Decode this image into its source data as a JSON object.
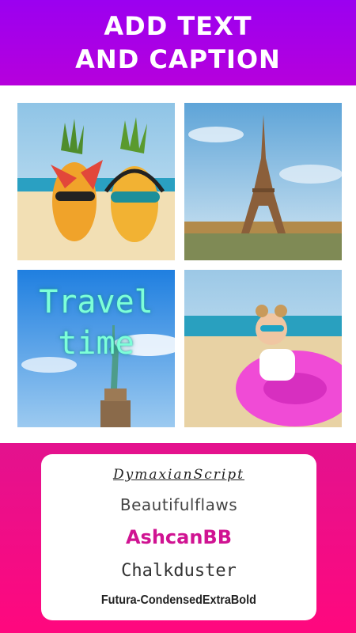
{
  "banner": {
    "line1": "ADD TEXT",
    "line2": "AND CAPTION"
  },
  "collage": {
    "tiles": [
      {
        "name": "pineapples-beach-photo"
      },
      {
        "name": "eiffel-tower-photo"
      },
      {
        "name": "statue-of-liberty-photo",
        "overlay_line1": "Travel",
        "overlay_line2": "time"
      },
      {
        "name": "woman-pink-float-photo"
      }
    ]
  },
  "font_list": {
    "items": [
      "DymaxianScript",
      "Beautifulflaws",
      "AshcanBB",
      "Chalkduster",
      "Futura-CondensedExtraBold"
    ],
    "selected_color": "#d01392"
  },
  "colors": {
    "banner": "#a600e8",
    "bottom": "#f0107f"
  }
}
